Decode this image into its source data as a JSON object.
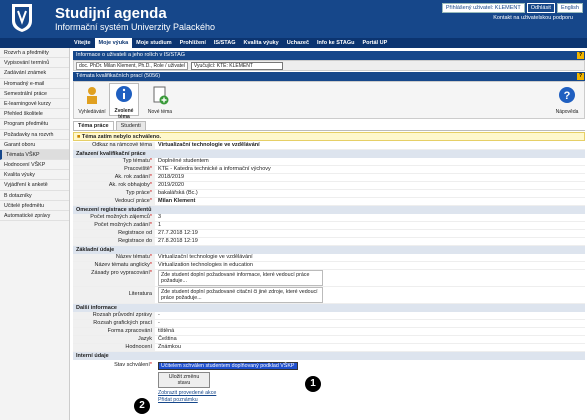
{
  "header": {
    "title": "Studijní agenda",
    "subtitle": "Informační systém Univerzity Palackého",
    "logged_user": "Přihlášený uživatel: KLEMENT",
    "logout": "Odhlásit",
    "english": "English",
    "contact": "Kontakt na uživatelskou podporu"
  },
  "nav": [
    "Vítejte",
    "Moje výuka",
    "Moje studium",
    "Prohlížení",
    "IS/STAG",
    "Kvalita výuky",
    "Uchazeč",
    "Info ke STAGu",
    "Portál UP"
  ],
  "sidebar": [
    "Rozvrh a předměty",
    "Vypisování termínů",
    "Zadávání známek",
    "Hromadný e-mail",
    "Semestrální práce",
    "E-learningové kurzy",
    "Přehled školitele",
    "Program předmětu",
    "Požadavky na rozvrh",
    "Garant oboru",
    "Témata VŠKP",
    "Hodnocení VŠKP",
    "Kvalita výuky",
    "Vyjádření k anketě",
    "B dotazníky",
    "Učitelé předmětu",
    "Automatické zprávy"
  ],
  "user_bar": {
    "title": "Informace o uživateli a jeho rolích v IS/STAG",
    "user": "doc. PhDr. Milan Klement, Ph.D., Role / uživatel",
    "role_select": "Vyučující: KTE: KLEMENT"
  },
  "toolbar": {
    "title": "Témata kvalifikačních prací (5056)",
    "tools": [
      "Vyhledávání",
      "Zvolené téma",
      "Nové téma"
    ],
    "help": "Nápověda"
  },
  "tabs": [
    "Téma práce",
    "Studenti"
  ],
  "warning": "Téma zatím nebylo schváleno.",
  "form": {
    "link_label": "Odkaz na rámcové téma",
    "link_value": "Virtualizační technologie ve vzdělávání",
    "s1": "Zařazení kvalifikační práce",
    "r1": [
      [
        "Typ tématu",
        "Doplněné studentem"
      ],
      [
        "Pracoviště",
        "KTE - Katedra technické a informační výchovy"
      ],
      [
        "Ak. rok zadání",
        "2018/2019"
      ],
      [
        "Ak. rok obhajoby",
        "2019/2020"
      ],
      [
        "Typ práce",
        "bakalářská (Bc.)"
      ],
      [
        "Vedoucí práce",
        "Milan Klement"
      ]
    ],
    "s2": "Omezení registrace studentů",
    "r2": [
      [
        "Počet možných zájemců",
        "3"
      ],
      [
        "Počet možných zadání",
        "1"
      ],
      [
        "Registrace od",
        "27.7.2018 12:19"
      ],
      [
        "Registrace do",
        "27.8.2018 12:19"
      ]
    ],
    "s3": "Základní údaje",
    "r3": [
      [
        "Název tématu",
        "Virtualizační technologie ve vzdělávání"
      ],
      [
        "Název tématu anglicky",
        "Virtualization technologies in education"
      ]
    ],
    "zasady_label": "Zásady pro vypracování",
    "zasady_value": "Zde student doplní požadované informace, které vedoucí práce požaduje...",
    "lit_label": "Literatura",
    "lit_value": "Zde student doplní požadované citační či jiné zdroje, které vedoucí práce požaduje...",
    "s4": "Další informace",
    "r4": [
      [
        "Rozsah průvodní zprávy",
        "-"
      ],
      [
        "Rozsah grafických prací",
        "-"
      ],
      [
        "Forma zpracování",
        "tištěná"
      ],
      [
        "Jazyk",
        "Čeština"
      ],
      [
        "Hodnocení",
        "Známkou"
      ]
    ],
    "s5": "Interní údaje",
    "status_label": "Stav schválení",
    "status_value": "Učitelem schválen studentem doplňovaný podklad VŠKP",
    "save": "Uložit změnu stavu",
    "action1": "Zobrazit provedené akce",
    "action2": "Přidat poznámku"
  },
  "markers": [
    "1",
    "2"
  ]
}
